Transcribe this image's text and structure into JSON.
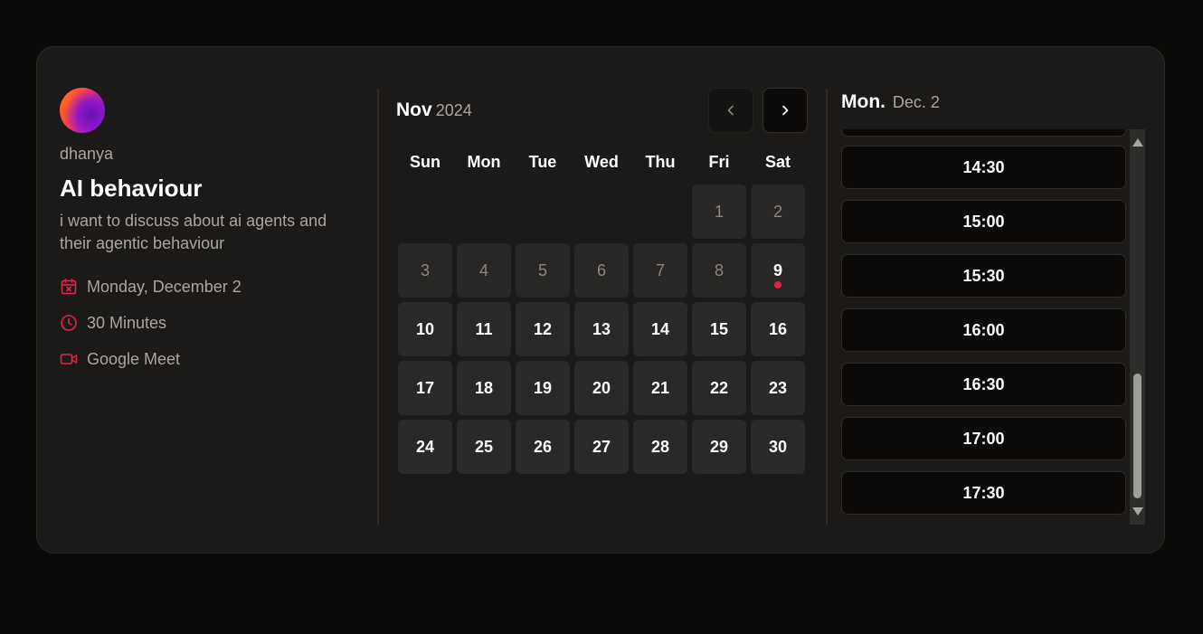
{
  "host": {
    "name": "dhanya"
  },
  "event": {
    "title": "AI behaviour",
    "description": "i want to discuss about ai agents and their agentic behaviour",
    "date": "Monday, December 2",
    "duration": "30 Minutes",
    "location": "Google Meet"
  },
  "calendar": {
    "month": "Nov",
    "year": "2024",
    "weekdays": [
      "Sun",
      "Mon",
      "Tue",
      "Wed",
      "Thu",
      "Fri",
      "Sat"
    ],
    "leading_empty": 5,
    "disabled_days": [
      "1",
      "2",
      "3",
      "4",
      "5",
      "6",
      "7",
      "8"
    ],
    "today": "9",
    "available_days": [
      "10",
      "11",
      "12",
      "13",
      "14",
      "15",
      "16",
      "17",
      "18",
      "19",
      "20",
      "21",
      "22",
      "23",
      "24",
      "25",
      "26",
      "27",
      "28",
      "29",
      "30"
    ]
  },
  "slots": {
    "day_label": "Mon.",
    "date_label": "Dec. 2",
    "times": [
      "14:30",
      "15:00",
      "15:30",
      "16:00",
      "16:30",
      "17:00",
      "17:30"
    ]
  },
  "colors": {
    "accent": "#e3224a",
    "background": "#0c0b0a",
    "card": "#1c1a18"
  },
  "icons": {
    "prev": "chevron-left-icon",
    "next": "chevron-right-icon",
    "date": "calendar-x-icon",
    "duration": "clock-icon",
    "location": "video-icon"
  }
}
